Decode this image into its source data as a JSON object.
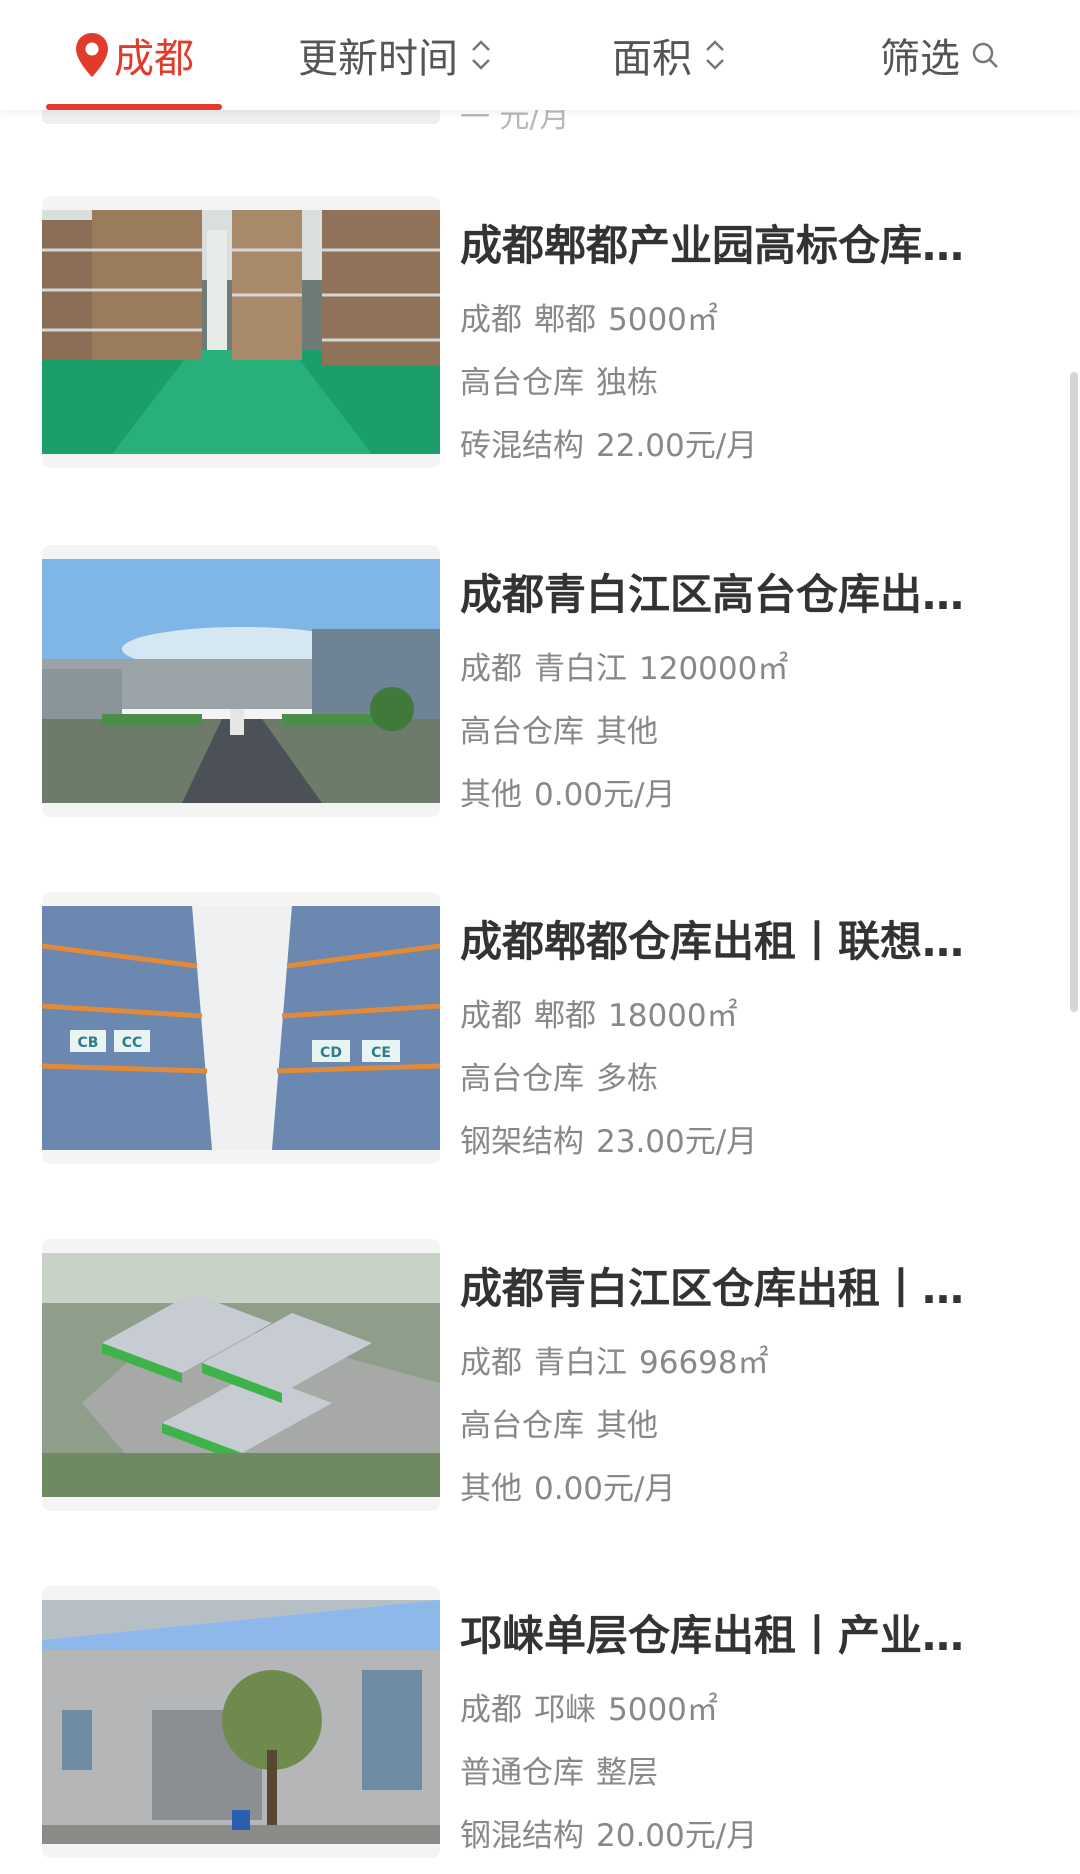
{
  "filter_bar": {
    "city": "成都",
    "sort_update": "更新时间",
    "sort_area": "面积",
    "filter": "筛选"
  },
  "peek": {
    "text": "一   元/月"
  },
  "listings": [
    {
      "title": "成都郫都产业园高标仓库…",
      "city": "成都",
      "district": "郫都",
      "area": "5000㎡",
      "type": "高台仓库",
      "building": "独栋",
      "structure": "砖混结构",
      "price": "22.00元/月"
    },
    {
      "title": "成都青白江区高台仓库出…",
      "city": "成都",
      "district": "青白江",
      "area": "120000㎡",
      "type": "高台仓库",
      "building": "其他",
      "structure": "其他",
      "price": "0.00元/月"
    },
    {
      "title": "成都郫都仓库出租丨联想…",
      "city": "成都",
      "district": "郫都",
      "area": "18000㎡",
      "type": "高台仓库",
      "building": "多栋",
      "structure": "钢架结构",
      "price": "23.00元/月",
      "rack_labels": [
        "CB",
        "CC",
        "CD",
        "CE"
      ]
    },
    {
      "title": "成都青白江区仓库出租丨…",
      "city": "成都",
      "district": "青白江",
      "area": "96698㎡",
      "type": "高台仓库",
      "building": "其他",
      "structure": "其他",
      "price": "0.00元/月"
    },
    {
      "title": "邛崃单层仓库出租丨产业…",
      "city": "成都",
      "district": "邛崃",
      "area": "5000㎡",
      "type": "普通仓库",
      "building": "整层",
      "structure": "钢混结构",
      "price": "20.00元/月"
    }
  ],
  "colors": {
    "accent": "#e23a2b",
    "title": "#333333",
    "meta": "#888888"
  },
  "icons": [
    "location-pin-icon",
    "sort-arrows-icon",
    "search-icon"
  ]
}
